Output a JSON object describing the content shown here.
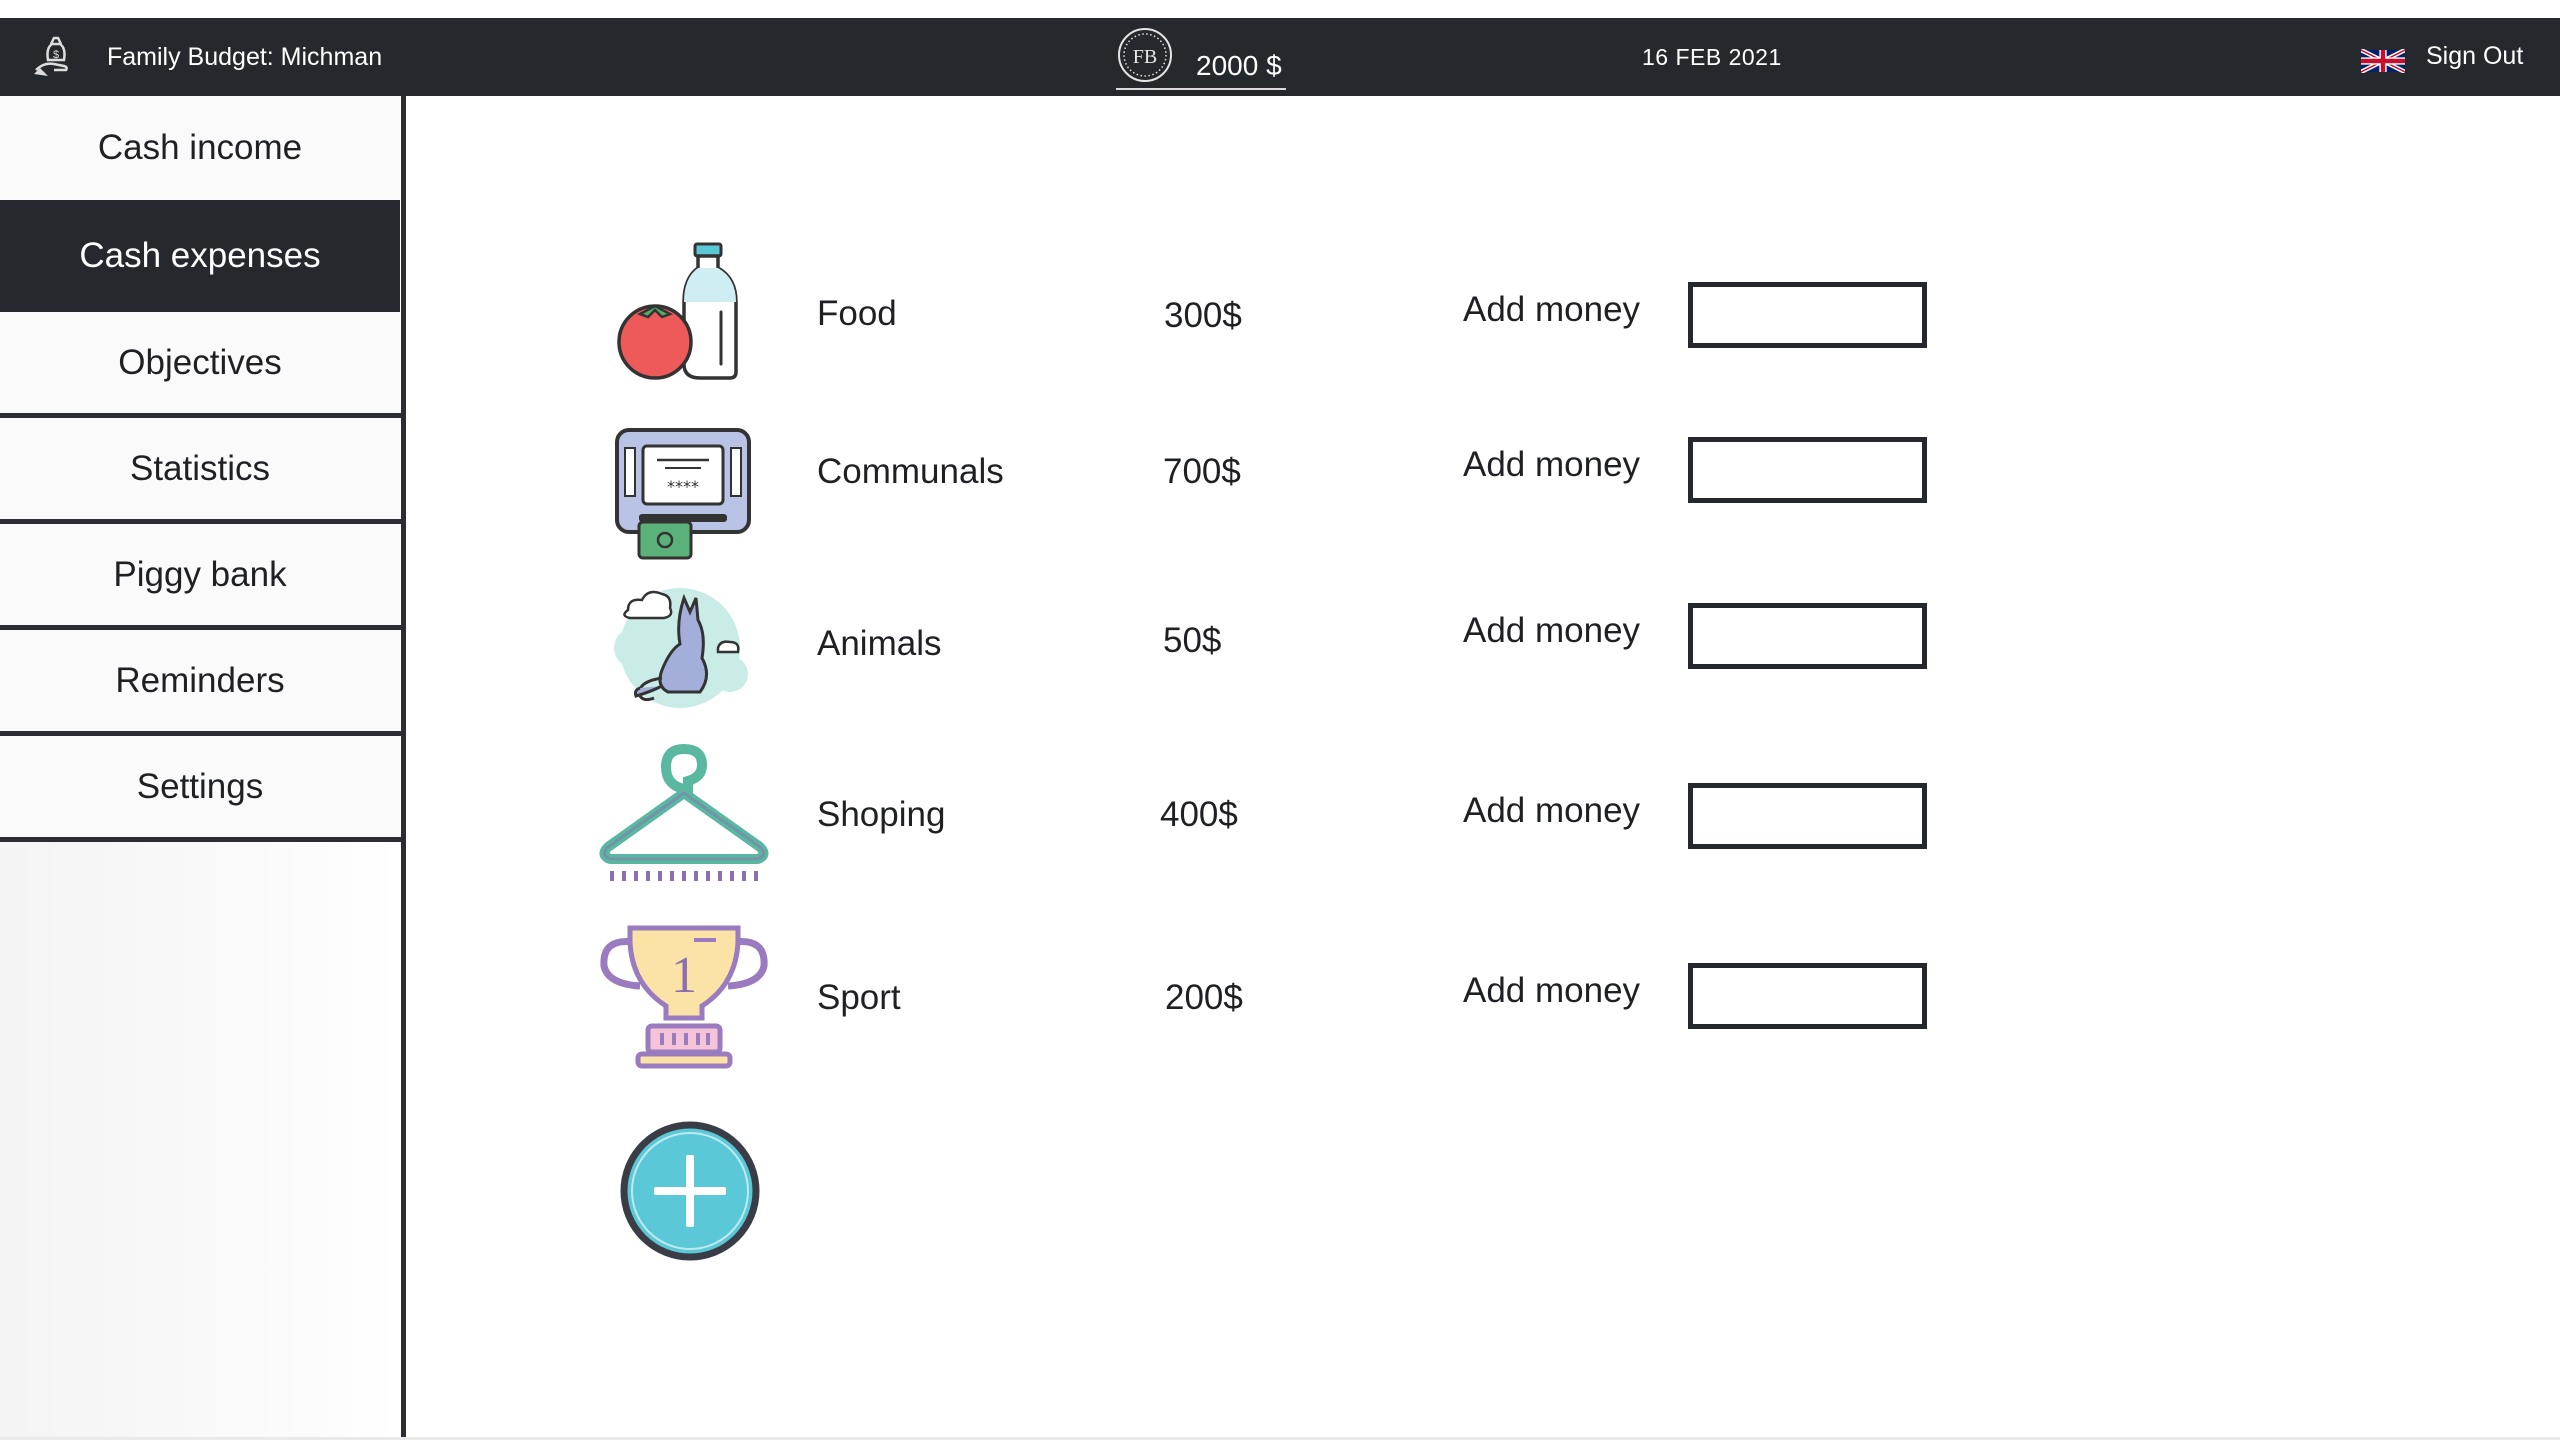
{
  "header": {
    "app_title": "Family Budget: Michman",
    "balance": "2000 $",
    "date": "16 FEB 2021",
    "sign_out": "Sign Out",
    "logo_icon": "budget-logo-icon",
    "balance_icon": "fb-coin-icon",
    "flag_icon": "uk-flag-icon"
  },
  "sidebar": {
    "items": [
      {
        "label": "Cash income",
        "active": false
      },
      {
        "label": "Cash expenses",
        "active": true
      },
      {
        "label": "Objectives",
        "active": false
      },
      {
        "label": "Statistics",
        "active": false
      },
      {
        "label": "Piggy bank",
        "active": false
      },
      {
        "label": "Reminders",
        "active": false
      },
      {
        "label": "Settings",
        "active": false
      }
    ]
  },
  "categories": [
    {
      "name": "Food",
      "amount": "300$",
      "action": "Add money",
      "icon": "food-icon",
      "input_value": ""
    },
    {
      "name": "Communals",
      "amount": "700$",
      "action": "Add money",
      "icon": "atm-icon",
      "input_value": ""
    },
    {
      "name": "Animals",
      "amount": "50$",
      "action": "Add money",
      "icon": "cat-icon",
      "input_value": ""
    },
    {
      "name": "Shoping",
      "amount": "400$",
      "action": "Add money",
      "icon": "hanger-icon",
      "input_value": ""
    },
    {
      "name": "Sport",
      "amount": "200$",
      "action": "Add money",
      "icon": "trophy-icon",
      "input_value": ""
    }
  ],
  "add_category_icon": "plus-circle-icon",
  "colors": {
    "topbar": "#25282d",
    "active_nav": "#25282d",
    "accent": "#5bc8d8",
    "text": "#1f2024"
  }
}
